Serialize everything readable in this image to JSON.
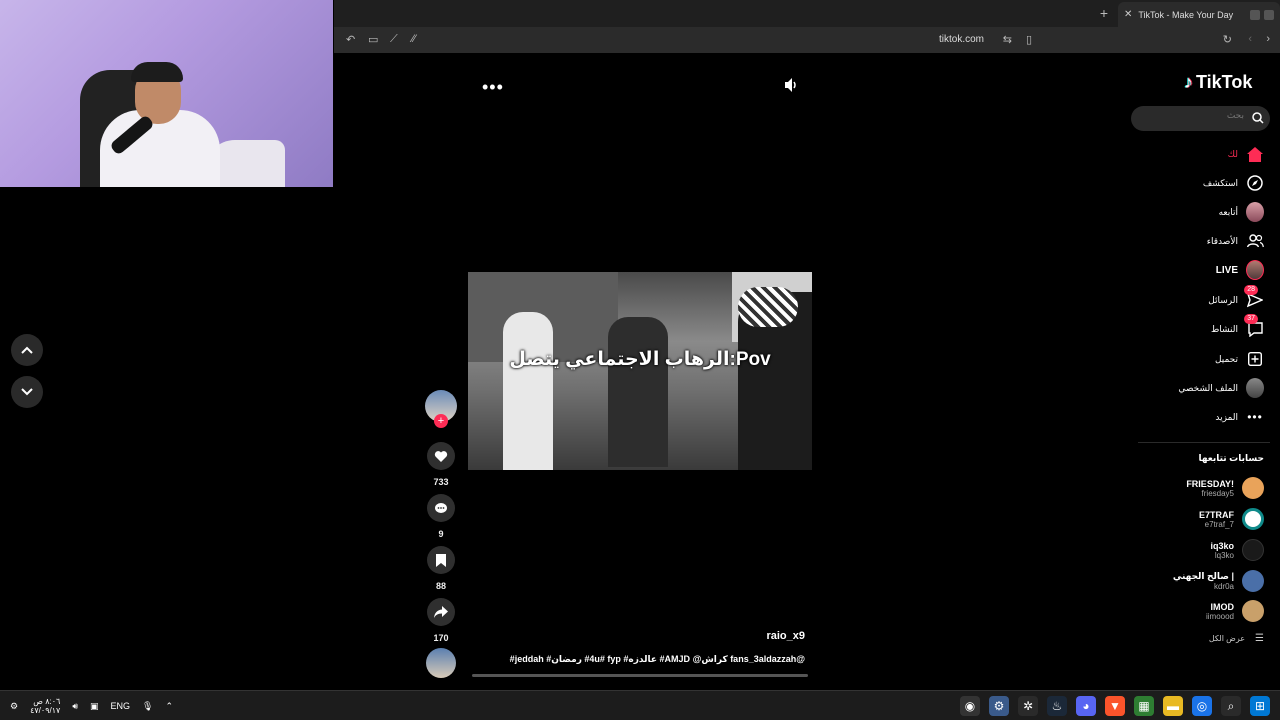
{
  "browser": {
    "tab_title": "TikTok - Make Your Day",
    "url": "tiktok.com"
  },
  "video": {
    "overlay_text": "Pov:الرهاب الاجتماعي يتصل",
    "username": "raio_x9",
    "caption": "@fans_3aldazzah كراش@ AMJD# عالدزه# 4u# fyp# رمضان# jeddah#",
    "likes": "733",
    "comments": "9",
    "saves": "88",
    "shares": "170"
  },
  "sidebar": {
    "logo": "TikTok",
    "search_placeholder": "بحث",
    "nav": [
      {
        "label": "لك",
        "icon": "home-icon",
        "active": true
      },
      {
        "label": "استكشف",
        "icon": "compass-icon"
      },
      {
        "label": "أتابعه",
        "icon": "following-avatar-icon"
      },
      {
        "label": "الأصدقاء",
        "icon": "friends-icon"
      },
      {
        "label": "LIVE",
        "icon": "live-avatar-icon"
      },
      {
        "label": "الرسائل",
        "icon": "messages-icon",
        "badge": "28"
      },
      {
        "label": "النشاط",
        "icon": "activity-icon",
        "badge": "37"
      },
      {
        "label": "تحميل",
        "icon": "upload-icon"
      },
      {
        "label": "الملف الشخصي",
        "icon": "profile-avatar-icon"
      },
      {
        "label": "المزيد",
        "icon": "more-icon"
      }
    ],
    "following_title": "حسابات تتابعها",
    "accounts": [
      {
        "name": "FRIESDAY!",
        "handle": "friesday5",
        "color": "#e9a35a"
      },
      {
        "name": "E7TRAF",
        "handle": "e7traf_7",
        "color": "#0f8a8a"
      },
      {
        "name": "iq3ko",
        "handle": "lq3ko",
        "color": "#1a1a1a"
      },
      {
        "name": "صالح الجهني |",
        "handle": "kdr0a",
        "color": "#4a6fa8"
      },
      {
        "name": "IMOD",
        "handle": "iimoood",
        "color": "#c9a06a"
      }
    ],
    "see_all": "عرض الكل"
  },
  "taskbar": {
    "time": "٨:٠٦ ص",
    "date": "٤٧/٠٩/١٧",
    "lang": "ENG"
  },
  "colors": {
    "accent": "#fe2c55",
    "background": "#000000"
  }
}
